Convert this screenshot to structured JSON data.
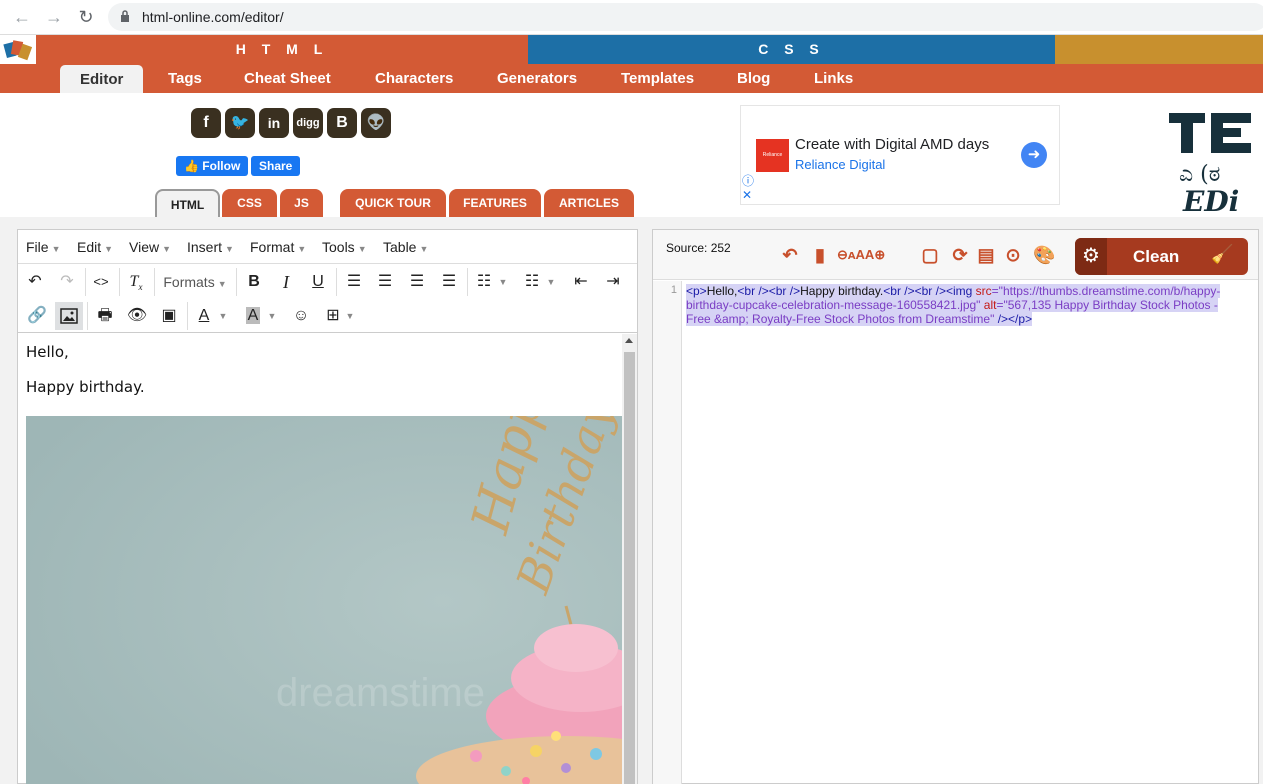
{
  "browser": {
    "url": "html-online.com/editor/"
  },
  "site": {
    "html_label": "H T M L",
    "css_label": "C S S",
    "nav": [
      "Editor",
      "Tags",
      "Cheat Sheet",
      "Characters",
      "Generators",
      "Templates",
      "Blog",
      "Links"
    ],
    "social": {
      "follow": "Follow",
      "share": "Share"
    },
    "tabs": [
      "HTML",
      "CSS",
      "JS",
      "QUICK TOUR",
      "FEATURES",
      "ARTICLES"
    ]
  },
  "ad": {
    "title": "Create with Digital AMD days",
    "advertiser": "Reliance Digital",
    "thumb_text": "Reliance Digital"
  },
  "editor": {
    "menus": [
      "File",
      "Edit",
      "View",
      "Insert",
      "Format",
      "Tools",
      "Table"
    ],
    "formats_label": "Formats",
    "content": {
      "line1": "Hello,",
      "line2": "Happy birthday."
    }
  },
  "source": {
    "count_label": "Source: 252",
    "clean_label": "Clean",
    "line_number": "1",
    "code": {
      "p_open": "<p>",
      "hello": "Hello,",
      "br1": "<br />",
      "br2": "<br />",
      "happy": "Happy birthday.",
      "br3": "<br />",
      "br4": "<br />",
      "img_open": "<img ",
      "src_attr": "src",
      "src_val": "=\"https://thumbs.dreamstime.com/b/happy-birthday-cupcake-celebration-message-160558421.jpg\"",
      "alt_attr": " alt",
      "alt_val": "=\"567,135 Happy Birthday Stock Photos - Free &amp; Royalty-Free Stock Photos from  Dreamstime\"",
      "img_close": " />",
      "p_close": "</p>"
    }
  },
  "colors": {
    "brand": "#d35a35",
    "css_blue": "#1d6fa6",
    "gold": "#c8902e",
    "clean_button": "#a63a1f"
  }
}
